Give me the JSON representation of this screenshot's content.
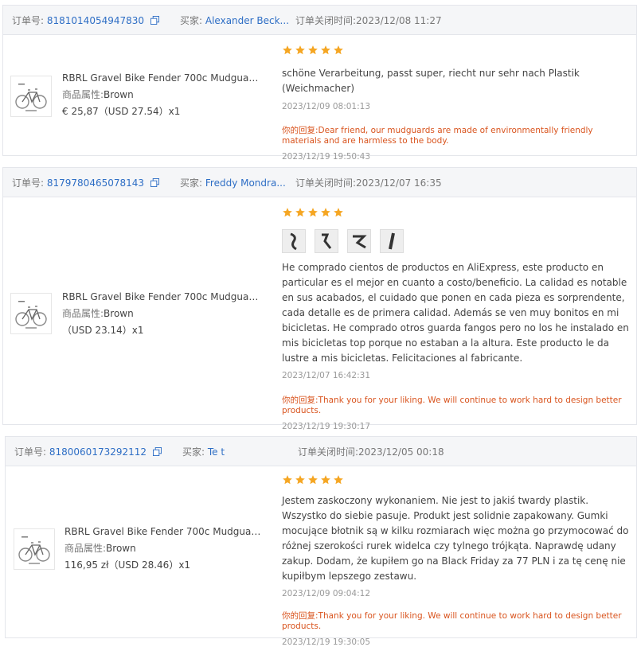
{
  "labels": {
    "order_no": "订单号:",
    "buyer": "买家:",
    "closed_time_prefix": "订单关闭时间:",
    "attr": "商品属性:",
    "reply_label": "你的回复:"
  },
  "colors": {
    "link": "#2e6ec5",
    "star": "#f5a623",
    "reply": "#d9541e",
    "header_bg": "#f5f6f8"
  },
  "icons": {
    "copy": "copy-icon",
    "star": "star-icon",
    "product": "bike-thumbnail"
  },
  "orders": [
    {
      "order_number": "8181014054947830",
      "buyer": "Alexander Beck...",
      "closed_time": "2023/12/08 11:27",
      "product_title": "RBRL Gravel Bike Fender 700c Mudguard F...",
      "attr_value": "Brown",
      "price": "€ 25,87（USD  27.54）x1",
      "rating": 5,
      "review": "schöne Verarbeitung, passt super, riecht nur sehr nach Plastik (Weichmacher)",
      "review_time": "2023/12/09 08:01:13",
      "reply": "Dear friend, our mudguards are made of environmentally friendly materials and are harmless to the body.",
      "reply_time": "2023/12/19 19:50:43"
    },
    {
      "order_number": "8179780465078143",
      "buyer": "Freddy Mondra...",
      "closed_time": "2023/12/07 16:35",
      "product_title": "RBRL Gravel Bike Fender 700c Mudguard F...",
      "attr_value": "Brown",
      "price": "（USD  23.14）x1",
      "rating": 5,
      "photos": 4,
      "review": "He comprado cientos de productos en AliExpress, este producto en particular es el mejor en cuanto a costo/beneficio. La calidad es notable en sus acabados, el cuidado que ponen en cada pieza es sorprendente, cada detalle es de primera calidad. Además se ven muy bonitos en mi bicicletas. He comprado otros guarda fangos pero no los he instalado en mis bicicletas top porque no estaban a la altura. Este producto le da lustre a mis bicicletas. Felicitaciones al fabricante.",
      "review_time": "2023/12/07 16:42:31",
      "reply": "Thank you for your liking. We will continue to work hard to design better products.",
      "reply_time": "2023/12/19 19:30:17"
    },
    {
      "order_number": "8180060173292112",
      "buyer": "Te t",
      "closed_time": "2023/12/05 00:18",
      "product_title": "RBRL Gravel Bike Fender 700c Mudguard F...",
      "attr_value": "Brown",
      "price": "116,95 zł（USD  28.46）x1",
      "rating": 5,
      "review": "Jestem zaskoczony wykonaniem. Nie jest to jakiś twardy plastik. Wszystko do siebie pasuje. Produkt jest solidnie zapakowany. Gumki mocujące błotnik są w kilku rozmiarach więc można go przymocować do różnej szerokości rurek widelca czy tylnego trójkąta. Naprawdę udany zakup. Dodam, że kupiłem go na Black Friday za 77 PLN i za tę cenę nie kupiłbym lepszego zestawu.",
      "review_time": "2023/12/09 09:04:12",
      "reply": "Thank you for your liking. We will continue to work hard to design better products.",
      "reply_time": "2023/12/19 19:30:05"
    }
  ]
}
